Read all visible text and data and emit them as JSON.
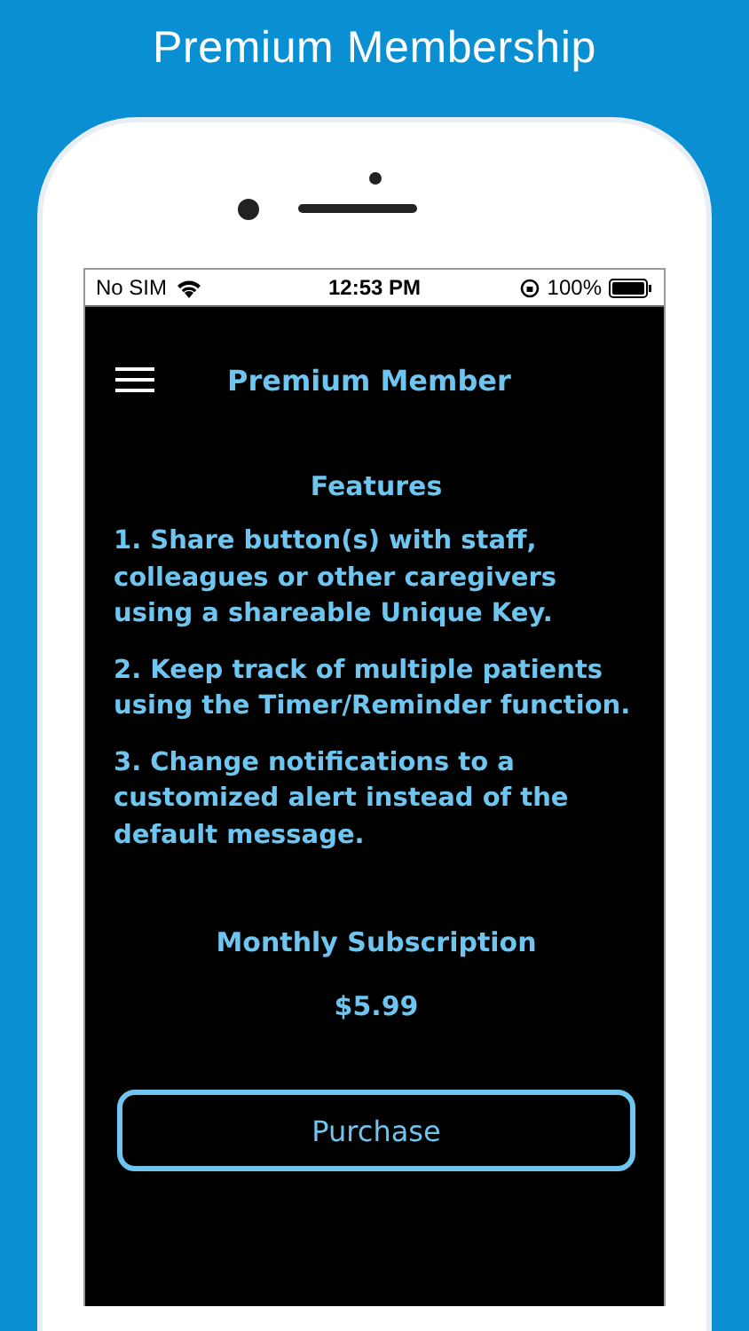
{
  "headline": "Premium Membership",
  "status_bar": {
    "carrier": "No SIM",
    "time": "12:53 PM",
    "battery": "100%"
  },
  "nav_bar": {
    "title": "Premium Member"
  },
  "features": {
    "heading": "Features",
    "items": [
      "1. Share button(s) with staff, colleagues or other caregivers using a shareable Unique Key.",
      "2. Keep track of multiple patients using the Timer/Reminder function.",
      "3. Change notifications to a customized alert instead of the default message."
    ]
  },
  "subscription": {
    "name": "Monthly Subscription",
    "price": "$5.99"
  },
  "purchase_button": "Purchase"
}
